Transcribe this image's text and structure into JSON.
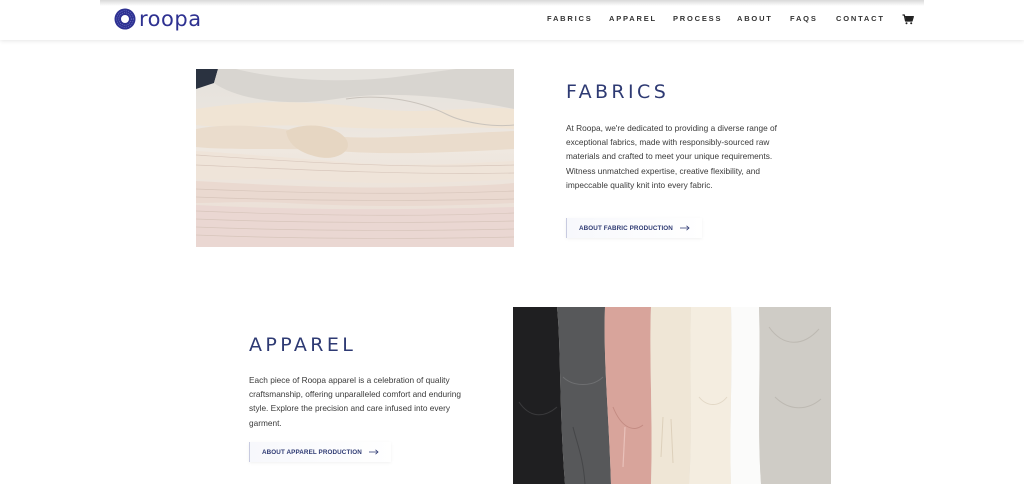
{
  "header": {
    "brand": "roopa",
    "nav": [
      {
        "label": "FABRICS"
      },
      {
        "label": "APPAREL"
      },
      {
        "label": "PROCESS"
      },
      {
        "label": "ABOUT"
      },
      {
        "label": "FAQS"
      },
      {
        "label": "CONTACT"
      }
    ],
    "cart_icon": "shopping-cart-icon"
  },
  "fabrics": {
    "title": "FABRICS",
    "body": "At Roopa, we're dedicated to providing a diverse range of exceptional fabrics, made with responsibly-sourced raw materials and crafted to meet your unique requirements. Witness unmatched expertise, creative flexibility, and impeccable quality knit into every fabric.",
    "cta": "ABOUT FABRIC PRODUCTION"
  },
  "apparel": {
    "title": "APPAREL",
    "body": "Each piece of Roopa apparel is a celebration of quality craftsmanship, offering unparalleled comfort and enduring style. Explore the precision and care infused into every garment.",
    "cta": "ABOUT APPAREL PRODUCTION"
  },
  "colors": {
    "brand": "#2e3191",
    "heading": "#2e3a73",
    "text": "#3a3a3a"
  }
}
